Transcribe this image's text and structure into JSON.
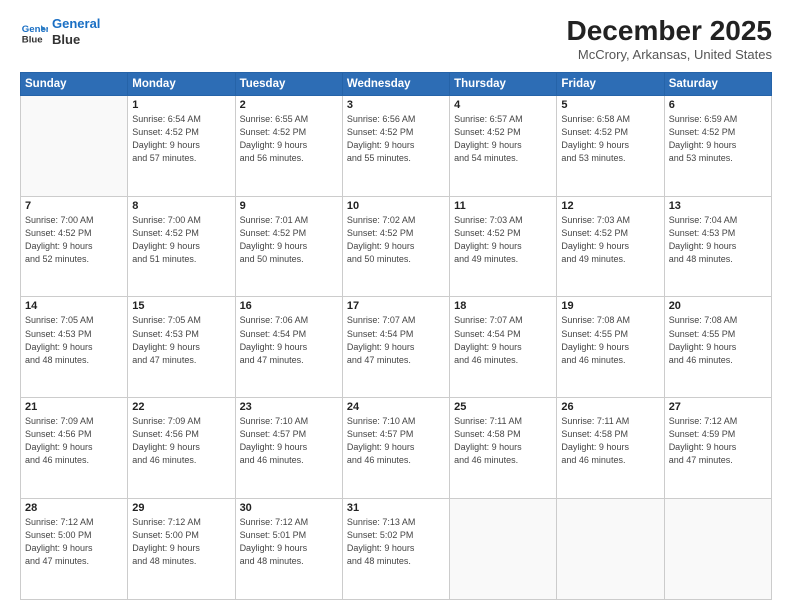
{
  "header": {
    "logo_line1": "General",
    "logo_line2": "Blue",
    "title": "December 2025",
    "subtitle": "McCrory, Arkansas, United States"
  },
  "weekdays": [
    "Sunday",
    "Monday",
    "Tuesday",
    "Wednesday",
    "Thursday",
    "Friday",
    "Saturday"
  ],
  "weeks": [
    [
      {
        "day": "",
        "info": ""
      },
      {
        "day": "1",
        "info": "Sunrise: 6:54 AM\nSunset: 4:52 PM\nDaylight: 9 hours\nand 57 minutes."
      },
      {
        "day": "2",
        "info": "Sunrise: 6:55 AM\nSunset: 4:52 PM\nDaylight: 9 hours\nand 56 minutes."
      },
      {
        "day": "3",
        "info": "Sunrise: 6:56 AM\nSunset: 4:52 PM\nDaylight: 9 hours\nand 55 minutes."
      },
      {
        "day": "4",
        "info": "Sunrise: 6:57 AM\nSunset: 4:52 PM\nDaylight: 9 hours\nand 54 minutes."
      },
      {
        "day": "5",
        "info": "Sunrise: 6:58 AM\nSunset: 4:52 PM\nDaylight: 9 hours\nand 53 minutes."
      },
      {
        "day": "6",
        "info": "Sunrise: 6:59 AM\nSunset: 4:52 PM\nDaylight: 9 hours\nand 53 minutes."
      }
    ],
    [
      {
        "day": "7",
        "info": "Sunrise: 7:00 AM\nSunset: 4:52 PM\nDaylight: 9 hours\nand 52 minutes."
      },
      {
        "day": "8",
        "info": "Sunrise: 7:00 AM\nSunset: 4:52 PM\nDaylight: 9 hours\nand 51 minutes."
      },
      {
        "day": "9",
        "info": "Sunrise: 7:01 AM\nSunset: 4:52 PM\nDaylight: 9 hours\nand 50 minutes."
      },
      {
        "day": "10",
        "info": "Sunrise: 7:02 AM\nSunset: 4:52 PM\nDaylight: 9 hours\nand 50 minutes."
      },
      {
        "day": "11",
        "info": "Sunrise: 7:03 AM\nSunset: 4:52 PM\nDaylight: 9 hours\nand 49 minutes."
      },
      {
        "day": "12",
        "info": "Sunrise: 7:03 AM\nSunset: 4:52 PM\nDaylight: 9 hours\nand 49 minutes."
      },
      {
        "day": "13",
        "info": "Sunrise: 7:04 AM\nSunset: 4:53 PM\nDaylight: 9 hours\nand 48 minutes."
      }
    ],
    [
      {
        "day": "14",
        "info": "Sunrise: 7:05 AM\nSunset: 4:53 PM\nDaylight: 9 hours\nand 48 minutes."
      },
      {
        "day": "15",
        "info": "Sunrise: 7:05 AM\nSunset: 4:53 PM\nDaylight: 9 hours\nand 47 minutes."
      },
      {
        "day": "16",
        "info": "Sunrise: 7:06 AM\nSunset: 4:54 PM\nDaylight: 9 hours\nand 47 minutes."
      },
      {
        "day": "17",
        "info": "Sunrise: 7:07 AM\nSunset: 4:54 PM\nDaylight: 9 hours\nand 47 minutes."
      },
      {
        "day": "18",
        "info": "Sunrise: 7:07 AM\nSunset: 4:54 PM\nDaylight: 9 hours\nand 46 minutes."
      },
      {
        "day": "19",
        "info": "Sunrise: 7:08 AM\nSunset: 4:55 PM\nDaylight: 9 hours\nand 46 minutes."
      },
      {
        "day": "20",
        "info": "Sunrise: 7:08 AM\nSunset: 4:55 PM\nDaylight: 9 hours\nand 46 minutes."
      }
    ],
    [
      {
        "day": "21",
        "info": "Sunrise: 7:09 AM\nSunset: 4:56 PM\nDaylight: 9 hours\nand 46 minutes."
      },
      {
        "day": "22",
        "info": "Sunrise: 7:09 AM\nSunset: 4:56 PM\nDaylight: 9 hours\nand 46 minutes."
      },
      {
        "day": "23",
        "info": "Sunrise: 7:10 AM\nSunset: 4:57 PM\nDaylight: 9 hours\nand 46 minutes."
      },
      {
        "day": "24",
        "info": "Sunrise: 7:10 AM\nSunset: 4:57 PM\nDaylight: 9 hours\nand 46 minutes."
      },
      {
        "day": "25",
        "info": "Sunrise: 7:11 AM\nSunset: 4:58 PM\nDaylight: 9 hours\nand 46 minutes."
      },
      {
        "day": "26",
        "info": "Sunrise: 7:11 AM\nSunset: 4:58 PM\nDaylight: 9 hours\nand 46 minutes."
      },
      {
        "day": "27",
        "info": "Sunrise: 7:12 AM\nSunset: 4:59 PM\nDaylight: 9 hours\nand 47 minutes."
      }
    ],
    [
      {
        "day": "28",
        "info": "Sunrise: 7:12 AM\nSunset: 5:00 PM\nDaylight: 9 hours\nand 47 minutes."
      },
      {
        "day": "29",
        "info": "Sunrise: 7:12 AM\nSunset: 5:00 PM\nDaylight: 9 hours\nand 48 minutes."
      },
      {
        "day": "30",
        "info": "Sunrise: 7:12 AM\nSunset: 5:01 PM\nDaylight: 9 hours\nand 48 minutes."
      },
      {
        "day": "31",
        "info": "Sunrise: 7:13 AM\nSunset: 5:02 PM\nDaylight: 9 hours\nand 48 minutes."
      },
      {
        "day": "",
        "info": ""
      },
      {
        "day": "",
        "info": ""
      },
      {
        "day": "",
        "info": ""
      }
    ]
  ]
}
